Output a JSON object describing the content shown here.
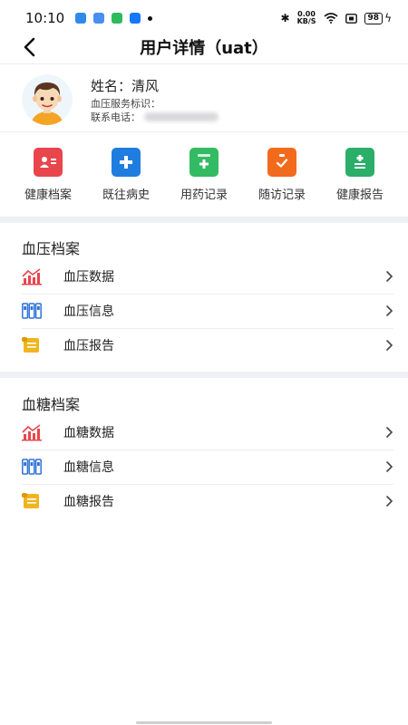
{
  "status_bar": {
    "time": "10:10",
    "net_speed_top": "0.00",
    "net_speed_bottom": "KB/S",
    "battery": "98"
  },
  "header": {
    "title": "用户详情（uat）"
  },
  "profile": {
    "name_label": "姓名：清风",
    "service_id_label": "血压服务标识：",
    "phone_label": "联系电话："
  },
  "quick_actions": [
    {
      "label": "健康档案",
      "icon": "profile-card-icon",
      "color": "#e8464c"
    },
    {
      "label": "既往病史",
      "icon": "add-document-icon",
      "color": "#1f7de0"
    },
    {
      "label": "用药记录",
      "icon": "medicine-box-icon",
      "color": "#33bb63"
    },
    {
      "label": "随访记录",
      "icon": "clipboard-check-icon",
      "color": "#f26b1d"
    },
    {
      "label": "健康报告",
      "icon": "report-document-icon",
      "color": "#2aae68"
    }
  ],
  "bp_section": {
    "title": "血压档案",
    "items": [
      {
        "label": "血压数据",
        "icon": "bar-chart-icon"
      },
      {
        "label": "血压信息",
        "icon": "binders-icon"
      },
      {
        "label": "血压报告",
        "icon": "scroll-report-icon"
      }
    ]
  },
  "bg_section": {
    "title": "血糖档案",
    "items": [
      {
        "label": "血糖数据",
        "icon": "bar-chart-icon"
      },
      {
        "label": "血糖信息",
        "icon": "binders-icon"
      },
      {
        "label": "血糖报告",
        "icon": "scroll-report-icon"
      }
    ]
  },
  "colors": {
    "chart_red": "#e8464c",
    "binder_blue": "#2f74d6",
    "report_yellow": "#f0b41e",
    "section_bg": "#eef0f4"
  }
}
